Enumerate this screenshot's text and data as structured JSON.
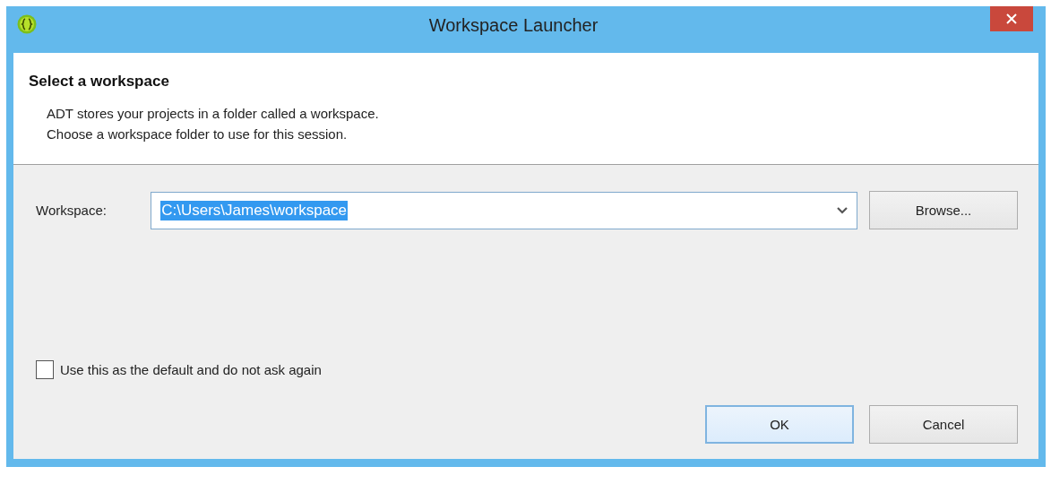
{
  "window": {
    "title": "Workspace Launcher"
  },
  "header": {
    "title": "Select a workspace",
    "description": [
      "ADT stores your projects in a folder called a workspace.",
      "Choose a workspace folder to use for this session."
    ]
  },
  "workspace": {
    "label": "Workspace:",
    "value": "C:\\Users\\James\\workspace",
    "selected": true
  },
  "browse_button": {
    "label": "Browse..."
  },
  "default_checkbox": {
    "label": "Use this as the default and do not ask again",
    "checked": false
  },
  "buttons": [
    {
      "label": "OK",
      "default": true
    },
    {
      "label": "Cancel",
      "default": false
    }
  ]
}
